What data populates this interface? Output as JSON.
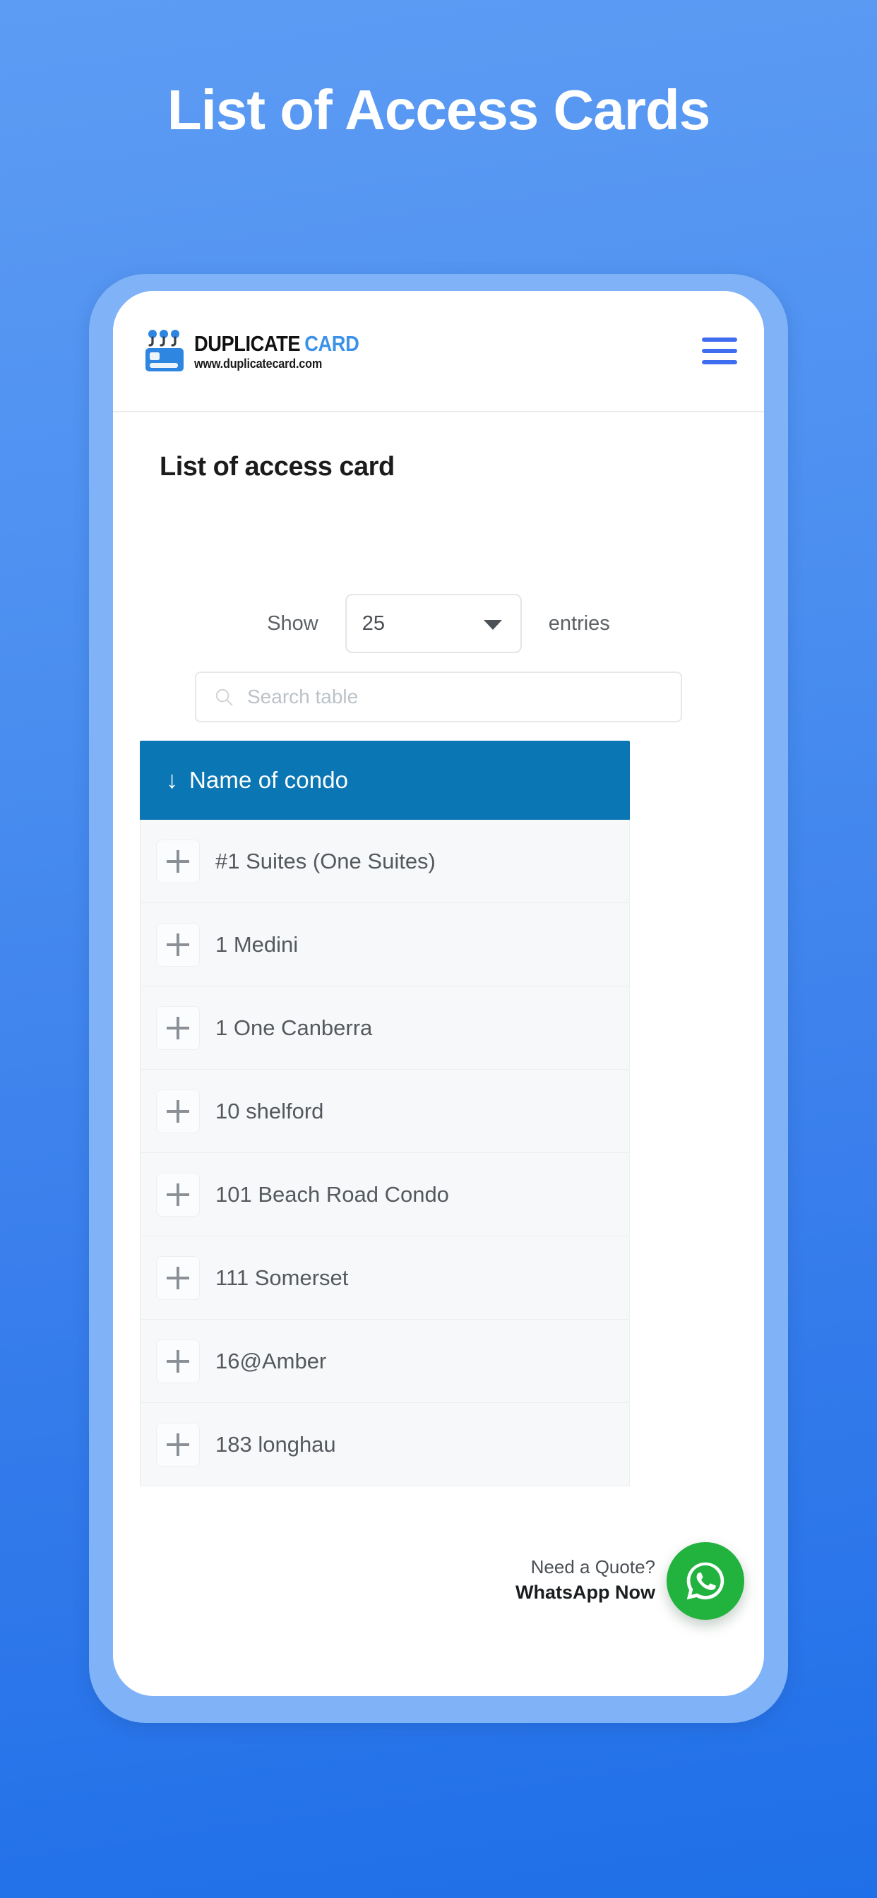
{
  "hero": {
    "title": "List of Access Cards"
  },
  "colors": {
    "background_top": "#5d9cf4",
    "background_bottom": "#1f6fe8",
    "phone_frame": "#7fb2f7",
    "brand_blue": "#3b92e8",
    "menu_blue": "#3f6df0",
    "table_header": "#0b76b4",
    "whatsapp_green": "#22b33f",
    "row_background": "#f6f8fa"
  },
  "app_header": {
    "brand": {
      "word_primary": "DUPLICATE",
      "word_accent": "CARD",
      "url": "www.duplicatecard.com",
      "mark_icon": "id-card-icon"
    },
    "menu_icon": "hamburger-menu-icon"
  },
  "page": {
    "heading": "List of access card"
  },
  "controls": {
    "length_prefix": "Show",
    "length_value": "25",
    "length_suffix": "entries",
    "length_options": [
      "25"
    ],
    "caret_icon": "chevron-down-icon"
  },
  "search": {
    "placeholder": "Search table",
    "value": "",
    "icon": "search-icon"
  },
  "table": {
    "sort_indicator": "↓",
    "sort_direction": "ascending",
    "columns": [
      "Name of condo"
    ],
    "header_label": "Name of condo",
    "expand_icon": "plus-icon",
    "rows": [
      {
        "name": "#1 Suites (One Suites)"
      },
      {
        "name": "1 Medini"
      },
      {
        "name": "1 One Canberra"
      },
      {
        "name": "10 shelford"
      },
      {
        "name": "101 Beach Road Condo"
      },
      {
        "name": "111 Somerset"
      },
      {
        "name": "16@Amber"
      },
      {
        "name": "183 longhau"
      }
    ]
  },
  "whatsapp_widget": {
    "line1": "Need a Quote?",
    "line2": "WhatsApp Now",
    "icon": "whatsapp-icon"
  }
}
